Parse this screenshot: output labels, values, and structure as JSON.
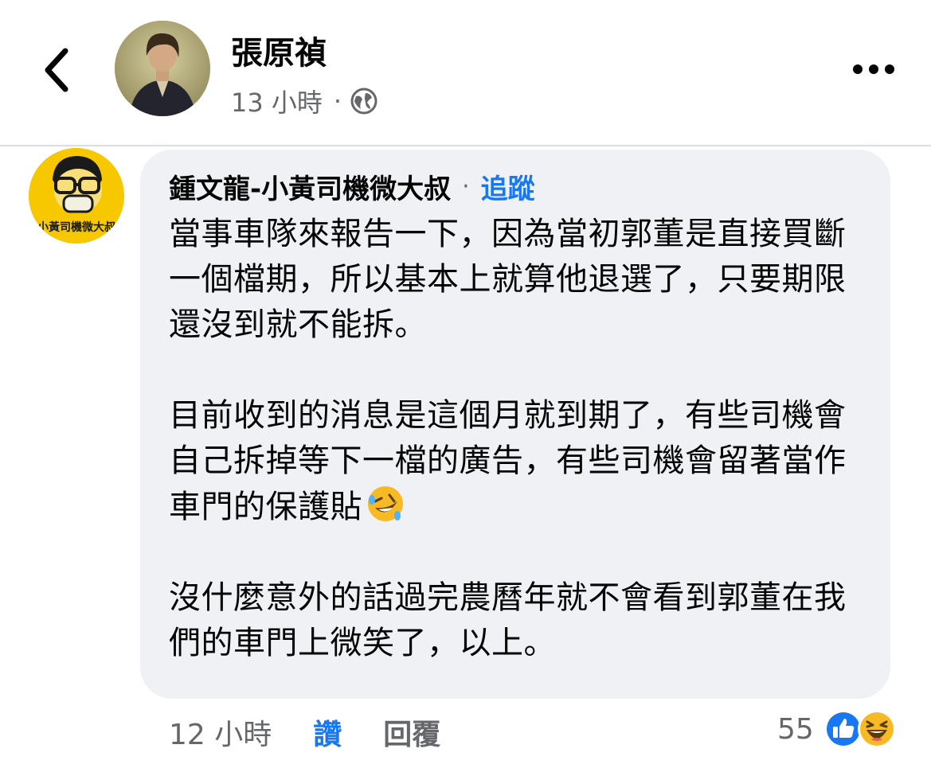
{
  "post": {
    "author": "張原禎",
    "time": "13 小時",
    "separator": "·",
    "privacy_icon": "globe-icon",
    "back_icon": "chevron-left-icon",
    "more_icon": "more-horizontal-icon"
  },
  "comment": {
    "author": "鍾文龍-小黃司機微大叔",
    "separator": "·",
    "follow_label": "追蹤",
    "avatar_caption": "小黃司機微大叔",
    "paragraphs": [
      "當事車隊來報告一下，因為當初郭董是直接買斷一個檔期，所以基本上就算他退選了，只要期限還沒到就不能拆。",
      "目前收到的消息是這個月就到期了，有些司機會自己拆掉等下一檔的廣告，有些司機會留著當作車門的保護貼",
      "沒什麼意外的話過完農曆年就不會看到郭董在我們的車門上微笑了，以上。"
    ],
    "inline_emoji": "rolling-on-floor-laughing-emoji",
    "time": "12 小時",
    "like_label": "讚",
    "reply_label": "回覆",
    "reaction_count": "55",
    "reaction_icons": [
      "like-reaction-icon",
      "haha-reaction-icon"
    ]
  },
  "colors": {
    "accent": "#1877f2",
    "secondary_text": "#65676b",
    "bubble": "#eff1f4",
    "avatar_yellow": "#f7c700"
  }
}
